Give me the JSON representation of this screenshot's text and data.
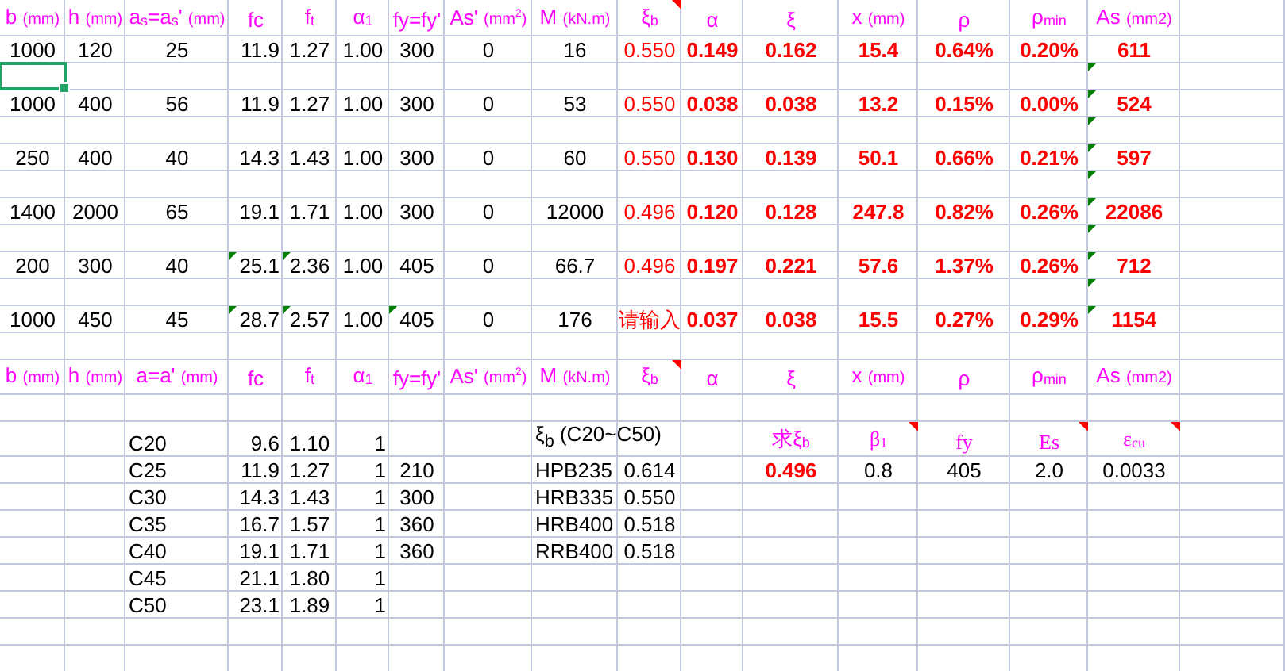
{
  "top_headers": [
    {
      "symbol": "b",
      "unit": "(mm)",
      "comment": false
    },
    {
      "symbol": "h",
      "unit": "(mm)",
      "comment": false
    },
    {
      "symbol": "a$_{s}$=a$_{s}$'",
      "unit": "(mm)",
      "comment": false
    },
    {
      "symbol": "fc",
      "comment": false
    },
    {
      "symbol": "f$_{t}$",
      "comment": false
    },
    {
      "symbol": "α$_{1}$",
      "comment": false
    },
    {
      "symbol": "fy=fy'",
      "comment": false
    },
    {
      "symbol": "As'",
      "unit": "(mm$^{2}$)",
      "comment": false
    },
    {
      "symbol": "M",
      "unit": "(kN.m)",
      "comment": false
    },
    {
      "symbol": "ξ$_{b}$",
      "comment": true
    },
    {
      "symbol": "α",
      "comment": false
    },
    {
      "symbol": "ξ",
      "comment": false
    },
    {
      "symbol": "x",
      "unit": "(mm)",
      "comment": false
    },
    {
      "symbol": "ρ",
      "comment": false
    },
    {
      "symbol": "ρ$_{min}$",
      "comment": false
    },
    {
      "symbol": "As",
      "unit": "(mm2)",
      "comment": false
    }
  ],
  "data_rows": [
    {
      "kind": "data",
      "values": [
        "1000",
        "120",
        "25",
        "11.9",
        "1.27",
        "1.00",
        "300",
        "0",
        "16",
        "0.550",
        "0.149",
        "0.162",
        "15.4",
        "0.64%",
        "0.20%",
        "611"
      ],
      "flags": [
        false,
        false,
        false,
        false,
        false,
        false,
        false,
        false,
        false,
        false,
        false,
        false,
        false,
        false,
        false,
        false
      ]
    },
    {
      "kind": "blank",
      "selected": true,
      "flag": true
    },
    {
      "kind": "data",
      "values": [
        "1000",
        "400",
        "56",
        "11.9",
        "1.27",
        "1.00",
        "300",
        "0",
        "53",
        "0.550",
        "0.038",
        "0.038",
        "13.2",
        "0.15%",
        "0.00%",
        "524"
      ],
      "flags": [
        false,
        false,
        false,
        false,
        false,
        false,
        false,
        false,
        false,
        false,
        false,
        false,
        false,
        false,
        false,
        true
      ]
    },
    {
      "kind": "blank",
      "selected": false,
      "flag": true
    },
    {
      "kind": "data",
      "values": [
        "250",
        "400",
        "40",
        "14.3",
        "1.43",
        "1.00",
        "300",
        "0",
        "60",
        "0.550",
        "0.130",
        "0.139",
        "50.1",
        "0.66%",
        "0.21%",
        "597"
      ],
      "flags": [
        false,
        false,
        false,
        false,
        false,
        false,
        false,
        false,
        false,
        false,
        false,
        false,
        false,
        false,
        false,
        true
      ]
    },
    {
      "kind": "blank",
      "selected": false,
      "flag": true
    },
    {
      "kind": "data",
      "values": [
        "1400",
        "2000",
        "65",
        "19.1",
        "1.71",
        "1.00",
        "300",
        "0",
        "12000",
        "0.496",
        "0.120",
        "0.128",
        "247.8",
        "0.82%",
        "0.26%",
        "22086"
      ],
      "flags": [
        false,
        false,
        false,
        false,
        false,
        false,
        false,
        false,
        false,
        false,
        false,
        false,
        false,
        false,
        false,
        true
      ]
    },
    {
      "kind": "blank",
      "selected": false,
      "flag": true
    },
    {
      "kind": "data",
      "values": [
        "200",
        "300",
        "40",
        "25.1",
        "2.36",
        "1.00",
        "405",
        "0",
        "66.7",
        "0.496",
        "0.197",
        "0.221",
        "57.6",
        "1.37%",
        "0.26%",
        "712"
      ],
      "flags": [
        false,
        false,
        false,
        true,
        true,
        false,
        false,
        false,
        false,
        false,
        false,
        false,
        false,
        false,
        false,
        true
      ]
    },
    {
      "kind": "blank",
      "selected": false,
      "flag": true
    },
    {
      "kind": "data",
      "values": [
        "1000",
        "450",
        "45",
        "28.7",
        "2.57",
        "1.00",
        "405",
        "0",
        "176",
        "请输入",
        "0.037",
        "0.038",
        "15.5",
        "0.27%",
        "0.29%",
        "1154"
      ],
      "flags": [
        false,
        false,
        false,
        true,
        true,
        false,
        true,
        false,
        false,
        false,
        false,
        false,
        false,
        false,
        false,
        true
      ]
    },
    {
      "kind": "blank",
      "selected": false,
      "flag": false
    }
  ],
  "lower_headers": [
    {
      "symbol": "b",
      "unit": "(mm)",
      "comment": false
    },
    {
      "symbol": "h",
      "unit": "(mm)",
      "comment": false
    },
    {
      "symbol": "a=a'",
      "unit": "(mm)",
      "comment": false
    },
    {
      "symbol": "fc",
      "comment": false
    },
    {
      "symbol": "f$_{t}$",
      "comment": false
    },
    {
      "symbol": "α$_{1}$",
      "comment": false
    },
    {
      "symbol": "fy=fy'",
      "comment": false
    },
    {
      "symbol": "As'",
      "unit": "(mm$^{2}$)",
      "comment": false
    },
    {
      "symbol": "M",
      "unit": "(kN.m)",
      "comment": false
    },
    {
      "symbol": "ξ$_{b}$",
      "comment": true
    },
    {
      "symbol": "α",
      "comment": false
    },
    {
      "symbol": "ξ",
      "comment": false
    },
    {
      "symbol": "x",
      "unit": "(mm)",
      "comment": false
    },
    {
      "symbol": "ρ",
      "comment": false
    },
    {
      "symbol": "ρ$_{min}$",
      "comment": false
    },
    {
      "symbol": "As",
      "unit": "(mm2)",
      "comment": false
    }
  ],
  "xi_b_title": "ξ$_{b}$  (C20~C50)",
  "concrete_table": [
    {
      "grade": "C20",
      "fc": "9.6",
      "ft": "1.10",
      "alpha1": "1"
    },
    {
      "grade": "C25",
      "fc": "11.9",
      "ft": "1.27",
      "alpha1": "1",
      "fy": "210",
      "steel": "HPB235",
      "xi_b": "0.614"
    },
    {
      "grade": "C30",
      "fc": "14.3",
      "ft": "1.43",
      "alpha1": "1",
      "fy": "300",
      "steel": "HRB335",
      "xi_b": "0.550"
    },
    {
      "grade": "C35",
      "fc": "16.7",
      "ft": "1.57",
      "alpha1": "1",
      "fy": "360",
      "steel": "HRB400",
      "xi_b": "0.518"
    },
    {
      "grade": "C40",
      "fc": "19.1",
      "ft": "1.71",
      "alpha1": "1",
      "fy": "360",
      "steel": "RRB400",
      "xi_b": "0.518"
    },
    {
      "grade": "C45",
      "fc": "21.1",
      "ft": "1.80",
      "alpha1": "1"
    },
    {
      "grade": "C50",
      "fc": "23.1",
      "ft": "1.89",
      "alpha1": "1"
    }
  ],
  "solver": [
    {
      "label": "求ξ$_{b}$",
      "value": "0.496",
      "comment": false,
      "kind": "result"
    },
    {
      "label": "β$_{1}$",
      "value": "0.8",
      "comment": true,
      "kind": "input"
    },
    {
      "label": "fy",
      "value": "405",
      "comment": false,
      "kind": "input"
    },
    {
      "label": "Es",
      "value": "2.0",
      "comment": true,
      "kind": "input"
    },
    {
      "label": "ε$_{cu}$",
      "value": "0.0033",
      "comment": true,
      "kind": "input"
    }
  ]
}
